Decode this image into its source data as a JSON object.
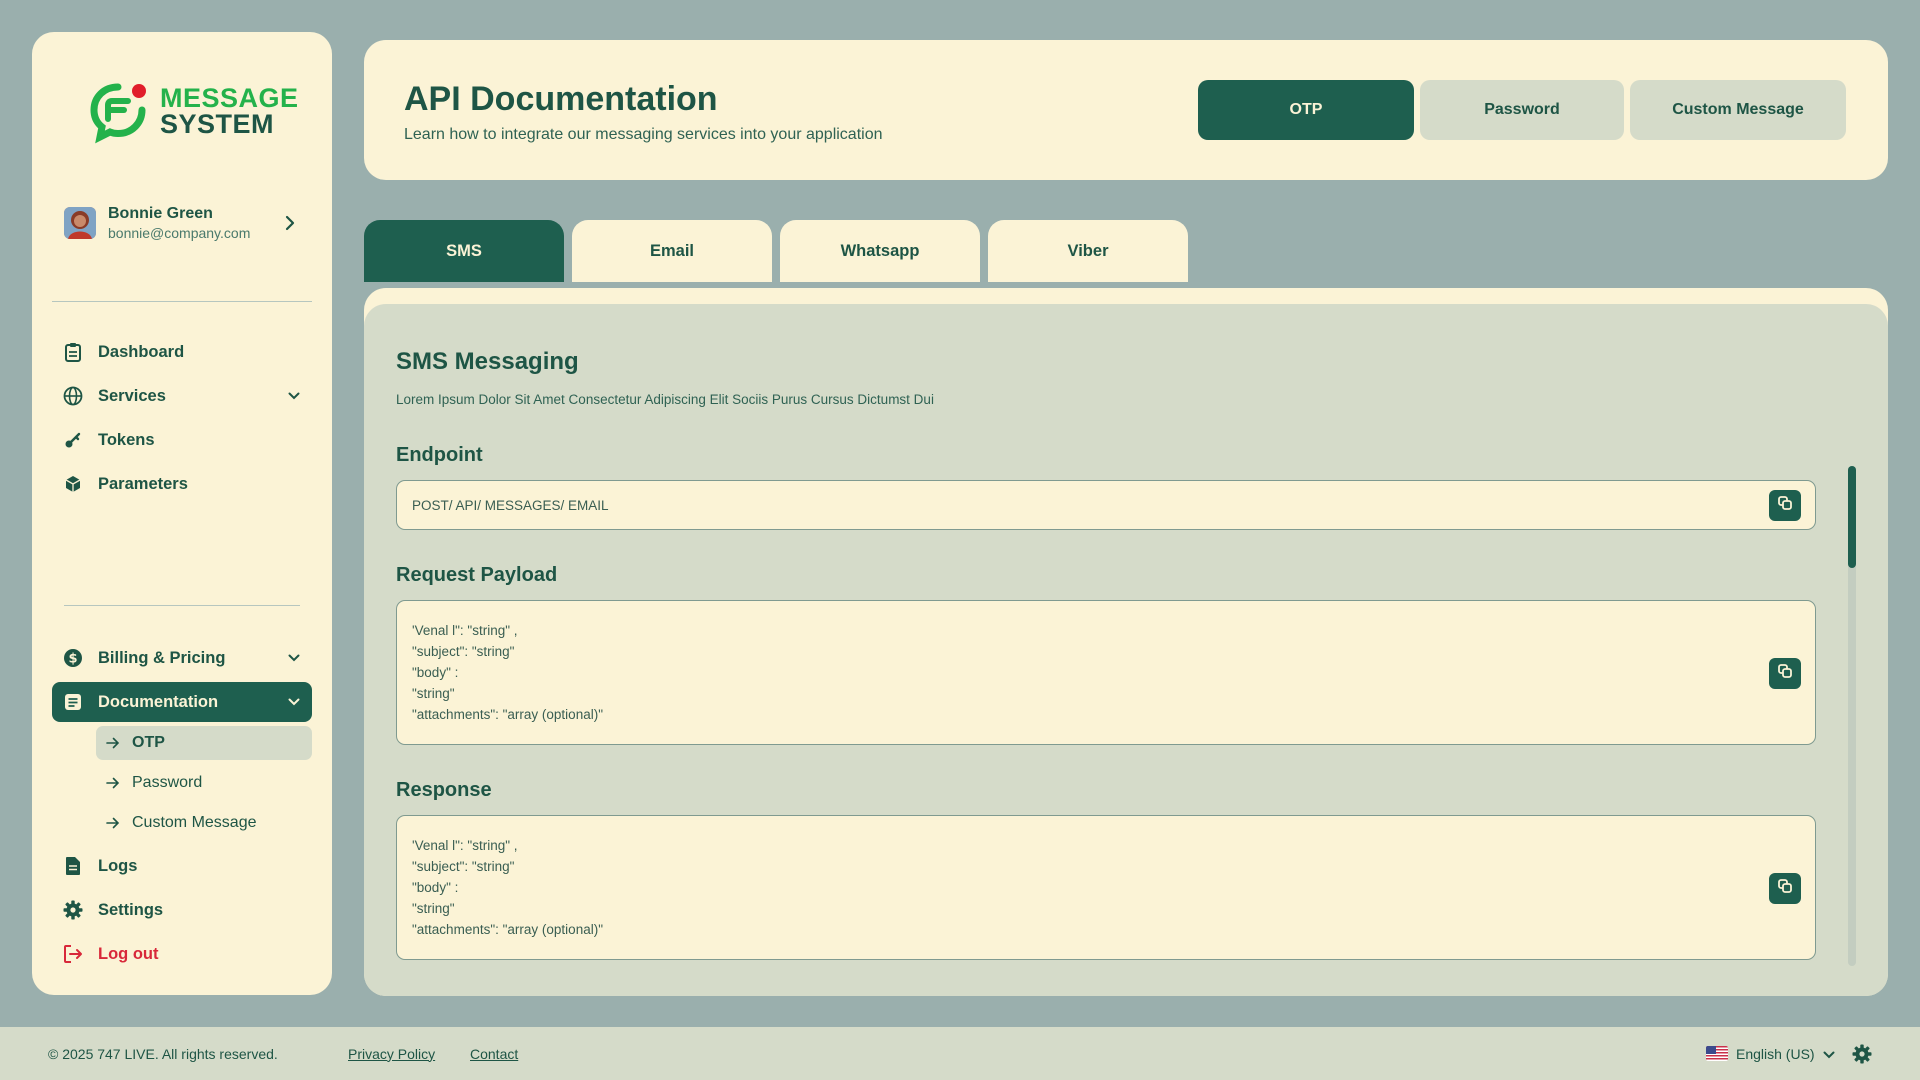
{
  "brand": {
    "line1": "MESSAGE",
    "line2": "SYSTEM"
  },
  "user": {
    "name": "Bonnie Green",
    "email": "bonnie@company.com"
  },
  "nav": {
    "dashboard": "Dashboard",
    "services": "Services",
    "tokens": "Tokens",
    "parameters": "Parameters",
    "billing": "Billing & Pricing",
    "documentation": "Documentation",
    "sub_otp": "OTP",
    "sub_password": "Password",
    "sub_custom": "Custom Message",
    "logs": "Logs",
    "settings": "Settings",
    "logout": "Log out"
  },
  "header": {
    "title": "API Documentation",
    "subtitle": "Learn how to integrate our messaging services into your application",
    "segments": [
      "OTP",
      "Password",
      "Custom Message"
    ],
    "active_segment": "OTP"
  },
  "tabs": [
    "SMS",
    "Email",
    "Whatsapp",
    "Viber"
  ],
  "active_tab": "SMS",
  "content": {
    "title": "SMS Messaging",
    "description": "Lorem Ipsum Dolor Sit Amet Consectetur Adipiscing Elit Sociis Purus Cursus Dictumst Dui",
    "endpoint_label": "Endpoint",
    "endpoint_value": "POST/ API/ MESSAGES/ EMAIL",
    "payload_label": "Request Payload",
    "payload_value": "'Venal l\": \"string\" ,\n\"subject\": \"string\"\n\"body\" :\n\"string\"\n\"attachments\": \"array (optional)\"",
    "response_label": "Response",
    "response_value": "'Venal l\": \"string\" ,\n\"subject\": \"string\"\n\"body\" :\n\"string\"\n\"attachments\": \"array (optional)\""
  },
  "footer": {
    "copyright": "© 2025 747 LIVE. All rights reserved.",
    "privacy": "Privacy Policy",
    "contact": "Contact",
    "language": "English (US)"
  },
  "colors": {
    "background": "#9aafad",
    "card": "#fbf3d6",
    "primary": "#1e5f4f",
    "muted": "#d5dbc9",
    "brand_green": "#24b24b",
    "logout_red": "#d8283a"
  }
}
